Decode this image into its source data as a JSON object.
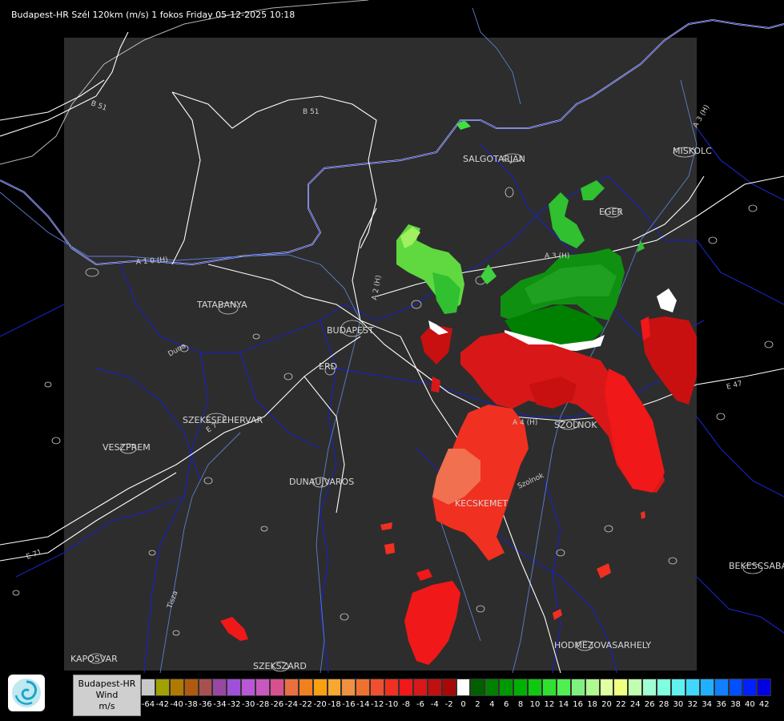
{
  "header": {
    "title": "Budapest-HR Szél 120km (m/s) 1 fokos Friday 05-12-2025 10:18"
  },
  "map": {
    "background_color": "#000000",
    "radar_area_color": "#2d2d2d",
    "cities": [
      "SALGOTARJAN",
      "EGER",
      "MISKOLC",
      "TATABANYA",
      "BUDAPEST",
      "ERD",
      "SZEKESFEHERVAR",
      "VESZPREM",
      "DUNAUJVAROS",
      "KECSKEMET",
      "SZOLNOK",
      "BEKESCSABA",
      "HODMEZOVASARHELY",
      "KAPOSVAR",
      "SZEKSZARD"
    ],
    "roads": [
      "B 51",
      "B 51",
      "A 3 (H)",
      "A 3 (H)",
      "A 2 (H)",
      "A 1 0 (H)",
      "A 4 (H)",
      "E 47",
      "E 7",
      "E 71",
      "Szolnok"
    ],
    "rivers": [
      "Duna",
      "Tisza"
    ]
  },
  "legend": {
    "station": "Budapest-HR",
    "quantity": "Wind",
    "unit": "m/s",
    "ticks": [
      "-64",
      "-42",
      "-40",
      "-38",
      "-36",
      "-34",
      "-32",
      "-30",
      "-28",
      "-26",
      "-24",
      "-22",
      "-20",
      "-18",
      "-16",
      "-14",
      "-12",
      "-10",
      "-8",
      "-6",
      "-4",
      "-2",
      "0",
      "2",
      "4",
      "6",
      "8",
      "10",
      "12",
      "14",
      "16",
      "18",
      "20",
      "22",
      "24",
      "26",
      "28",
      "30",
      "32",
      "34",
      "36",
      "38",
      "40",
      "42"
    ],
    "colors": [
      "#c8c8c8",
      "#a0a000",
      "#b07a00",
      "#b05a10",
      "#a85050",
      "#9848a0",
      "#a050d8",
      "#b858d8",
      "#c858c0",
      "#d85090",
      "#e87040",
      "#f08020",
      "#f8a010",
      "#f8a830",
      "#f09040",
      "#f07030",
      "#f05030",
      "#f03020",
      "#f01818",
      "#d81818",
      "#c01010",
      "#a80808",
      "#ffffff",
      "#006000",
      "#008000",
      "#009800",
      "#00b000",
      "#10c810",
      "#30e030",
      "#50f050",
      "#80f080",
      "#b0f890",
      "#e0ffa0",
      "#f0ff80",
      "#c0ffb0",
      "#a0ffd0",
      "#80ffe0",
      "#60f0f0",
      "#40d8ff",
      "#20b0ff",
      "#1080ff",
      "#0050ff",
      "#0020ff",
      "#0000e0"
    ]
  }
}
